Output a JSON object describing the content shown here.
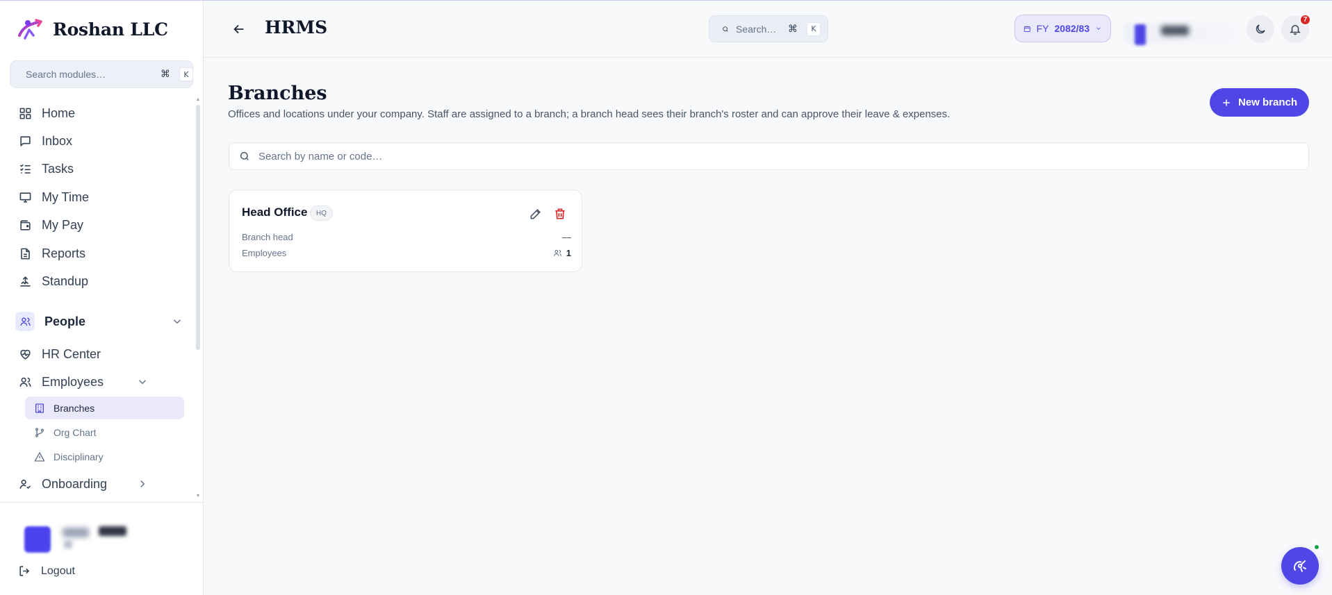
{
  "sidebar": {
    "brand": "Roshan LLC",
    "search": {
      "placeholder": "Search modules…",
      "kbd_cmd": "⌘",
      "kbd_key": "K"
    },
    "items": [
      {
        "label": "Home",
        "icon": "home-icon"
      },
      {
        "label": "Inbox",
        "icon": "inbox-icon"
      },
      {
        "label": "Tasks",
        "icon": "tasks-icon"
      },
      {
        "label": "My Time",
        "icon": "monitor-icon"
      },
      {
        "label": "My Pay",
        "icon": "wallet-icon"
      },
      {
        "label": "Reports",
        "icon": "report-icon"
      },
      {
        "label": "Standup",
        "icon": "standup-icon"
      }
    ],
    "section": {
      "label": "People",
      "icon": "users-icon"
    },
    "hr_center": "HR Center",
    "employees": {
      "label": "Employees"
    },
    "sub_items": [
      {
        "label": "Branches",
        "icon": "building-icon"
      },
      {
        "label": "Org Chart",
        "icon": "org-chart-icon"
      },
      {
        "label": "Disciplinary",
        "icon": "warning-icon"
      }
    ],
    "onboarding": "Onboarding",
    "logout": "Logout"
  },
  "topbar": {
    "title": "HRMS",
    "search": {
      "placeholder": "Search…",
      "kbd_cmd": "⌘",
      "kbd_key": "K"
    },
    "fy_prefix": "FY",
    "fy_value": "2082/83",
    "notification_count": "7"
  },
  "main": {
    "title": "Branches",
    "description": "Offices and locations under your company. Staff are assigned to a branch; a branch head sees their branch's roster and can approve their leave & expenses.",
    "new_button": "New branch",
    "search_placeholder": "Search by name or code…",
    "branches": [
      {
        "name": "Head Office",
        "code": "HQ",
        "head_label": "Branch head",
        "head_value": "—",
        "employees_label": "Employees",
        "employees_value": "1"
      }
    ]
  },
  "colors": {
    "accent": "#4f46e5",
    "active_bg": "#e9e9fb",
    "danger": "#dc2626",
    "online": "#16a34a"
  }
}
